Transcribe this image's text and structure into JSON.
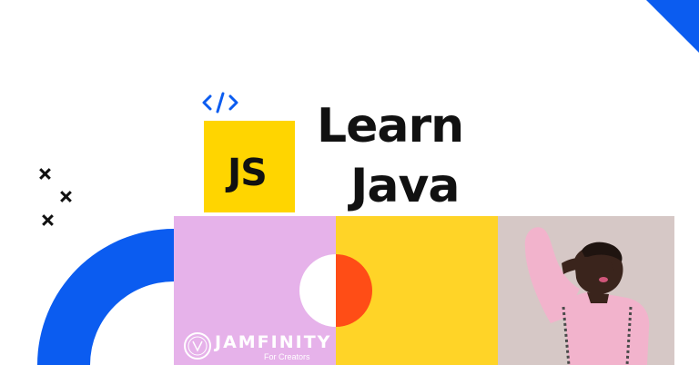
{
  "title": {
    "line1": "Learn",
    "line2": "Java"
  },
  "badge": {
    "text": "JS",
    "icon": "code-icon"
  },
  "logo": {
    "name": "JAMFINITY",
    "tagline": "For Creators"
  },
  "decorations": {
    "icons": [
      "close-icon",
      "close-icon",
      "close-icon"
    ]
  },
  "colors": {
    "blue": "#0b5cf0",
    "yellow": "#ffd500",
    "pink": "#e6b2ea",
    "orange": "#ff4d16",
    "text": "#111111",
    "photo_bg": "#d9ccc9"
  }
}
